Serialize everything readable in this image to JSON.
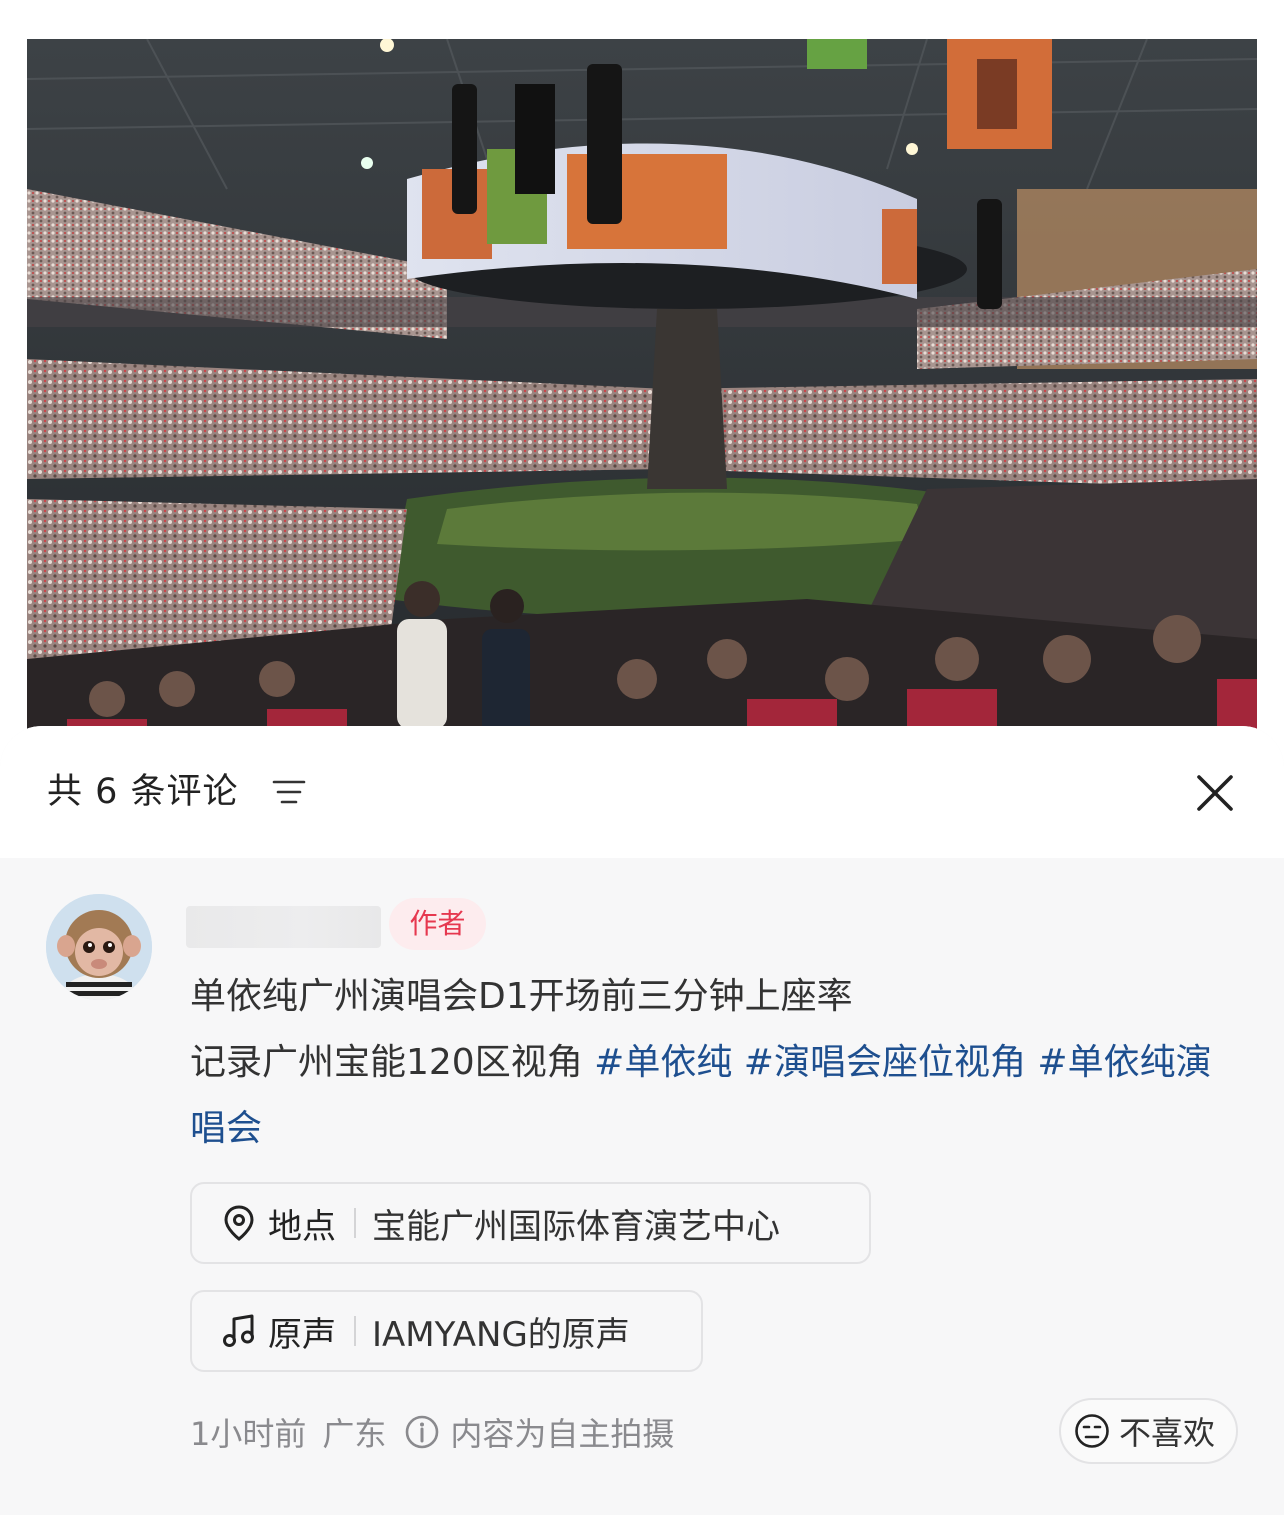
{
  "header": {
    "comment_count_label": "共 6 条评论"
  },
  "comment": {
    "author_badge": "作者",
    "text_line1": "单依纯广州演唱会D1开场前三分钟上座率",
    "text_line2_prefix": "记录广州宝能120区视角 ",
    "hashtags": [
      "#单依纯",
      "#演唱会座位视角",
      "#单依纯演唱会"
    ],
    "location": {
      "label": "地点",
      "value": "宝能广州国际体育演艺中心",
      "icon": "location-pin-icon"
    },
    "sound": {
      "label": "原声",
      "value": "IAMYANG的原声",
      "icon": "music-note-icon"
    },
    "meta": {
      "time": "1小时前",
      "region": "广东",
      "notice": "内容为自主拍摄"
    },
    "dislike_label": "不喜欢"
  },
  "colors": {
    "hashtag": "#1e4f8f",
    "badge_text": "#e6384f",
    "badge_bg": "#fdecee"
  }
}
